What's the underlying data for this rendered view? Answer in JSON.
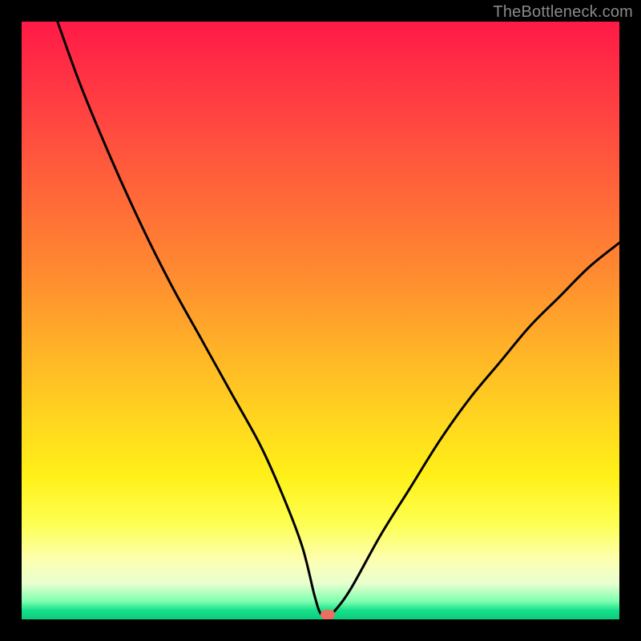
{
  "watermark": "TheBottleneck.com",
  "marker": {
    "x_frac": 0.512,
    "y_frac": 0.992
  },
  "chart_data": {
    "type": "line",
    "title": "",
    "xlabel": "",
    "ylabel": "",
    "xlim": [
      0,
      100
    ],
    "ylim": [
      0,
      100
    ],
    "series": [
      {
        "name": "curve",
        "x": [
          6,
          10,
          15,
          20,
          25,
          30,
          35,
          40,
          44,
          47,
          49,
          50,
          51,
          52,
          55,
          60,
          65,
          70,
          75,
          80,
          85,
          90,
          95,
          100
        ],
        "values": [
          100,
          89,
          77,
          66,
          56,
          47,
          38,
          29,
          20,
          12,
          4,
          1,
          0.8,
          1,
          5,
          14,
          22,
          30,
          37,
          43,
          49,
          54,
          59,
          63
        ]
      }
    ],
    "annotations": [
      {
        "type": "marker",
        "x": 51.2,
        "y": 0.8,
        "color": "#e97060"
      },
      {
        "type": "watermark",
        "text": "TheBottleneck.com"
      }
    ]
  }
}
